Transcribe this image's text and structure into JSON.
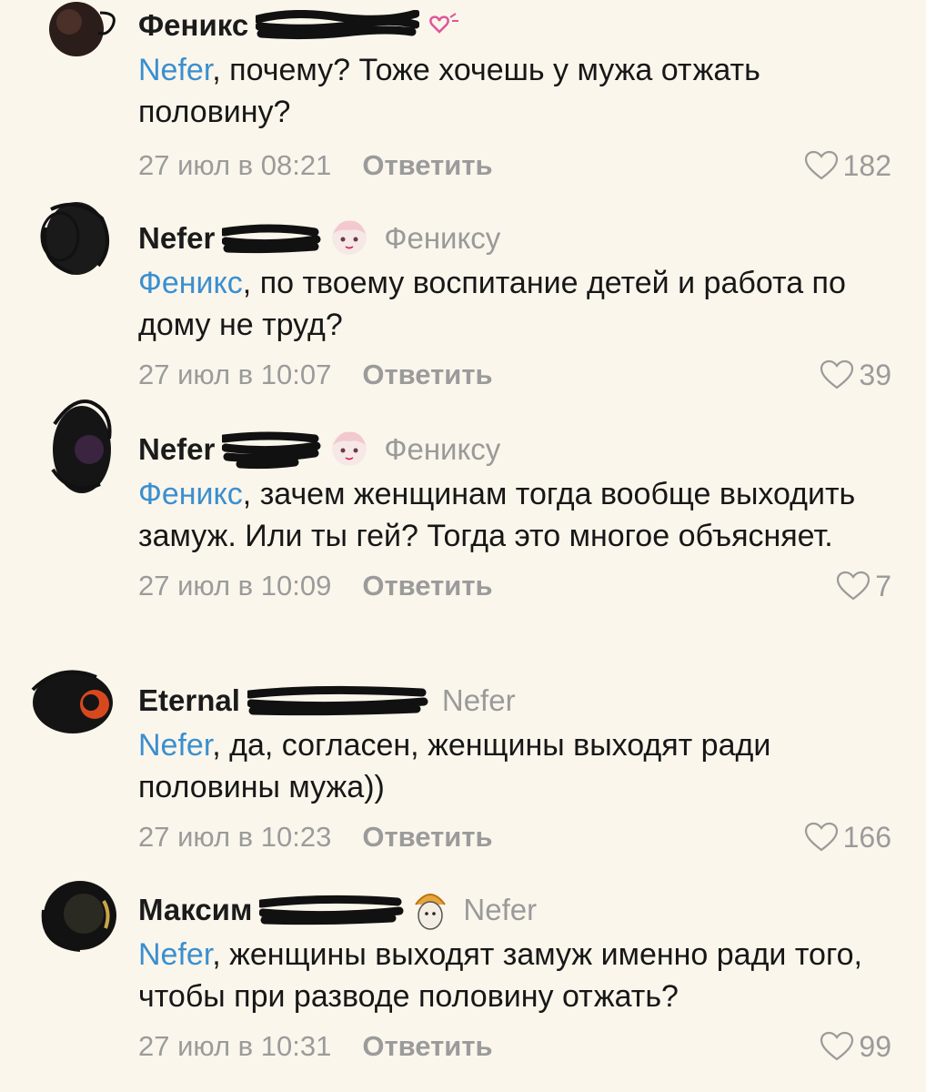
{
  "comments": [
    {
      "author": "Феникс",
      "reply_to": "",
      "mention": "Nefer",
      "text": ", почему? Тоже хочешь у мужа отжать половину?",
      "date": "27 июл в 08:21",
      "reply_label": "Ответить",
      "likes": "182"
    },
    {
      "author": "Nefer",
      "reply_to": "Фениксу",
      "mention": "Феникс",
      "text": ", по твоему воспитание детей и работа по дому не труд?",
      "date": "27 июл в 10:07",
      "reply_label": "Ответить",
      "likes": "39"
    },
    {
      "author": "Nefer",
      "reply_to": "Фениксу",
      "mention": "Феникс",
      "text": ", зачем женщинам тогда вообще выходить замуж. Или ты гей? Тогда это многое объясняет.",
      "date": "27 июл в 10:09",
      "reply_label": "Ответить",
      "likes": "7"
    },
    {
      "author": "Eternal",
      "reply_to": "Nefer",
      "mention": "Nefer",
      "text": ", да, согласен, женщины выходят ради половины мужа))",
      "date": "27 июл в 10:23",
      "reply_label": "Ответить",
      "likes": "166"
    },
    {
      "author": "Максим",
      "reply_to": "Nefer",
      "mention": "Nefer",
      "text": ", женщины выходят замуж именно ради того, чтобы при разводе половину отжать?",
      "date": "27 июл в 10:31",
      "reply_label": "Ответить",
      "likes": "99"
    }
  ],
  "colors": {
    "background": "#fbf6ec",
    "mention": "#3a8fcf",
    "muted": "#9b9b9b"
  },
  "icons": {
    "like": "heart-outline-icon",
    "avatar": "avatar-scribbled"
  }
}
